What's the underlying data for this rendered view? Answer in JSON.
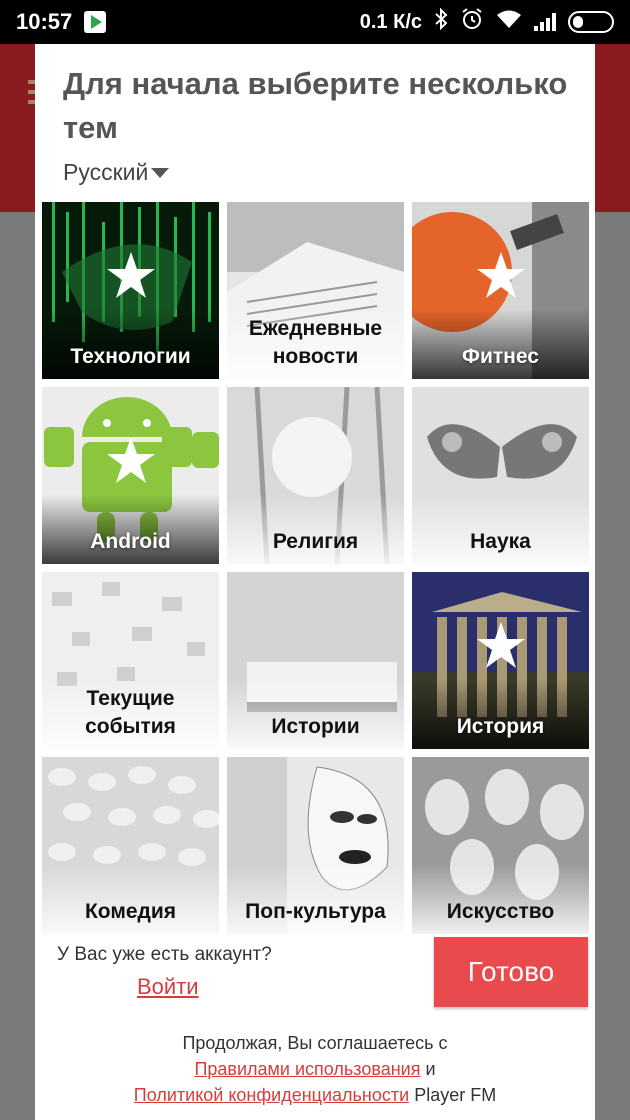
{
  "status_bar": {
    "time": "10:57",
    "network_speed": "0.1 К/с",
    "icons": [
      "google-play-icon",
      "bluetooth-icon",
      "alarm-icon",
      "wifi-icon",
      "signal-icon",
      "battery-icon"
    ]
  },
  "dialog": {
    "title": "Для начала выберите несколько тем",
    "language": "Русский",
    "topics": [
      {
        "label": "Технологии",
        "selected": true,
        "style": "dark"
      },
      {
        "label": "Ежедневные новости",
        "selected": false,
        "style": "light"
      },
      {
        "label": "Фитнес",
        "selected": true,
        "style": "dark"
      },
      {
        "label": "Android",
        "selected": true,
        "style": "dark"
      },
      {
        "label": "Религия",
        "selected": false,
        "style": "light"
      },
      {
        "label": "Наука",
        "selected": false,
        "style": "light"
      },
      {
        "label": "Текущие события",
        "selected": false,
        "style": "light"
      },
      {
        "label": "Истории",
        "selected": false,
        "style": "light"
      },
      {
        "label": "История",
        "selected": true,
        "style": "dark"
      },
      {
        "label": "Комедия",
        "selected": false,
        "style": "light"
      },
      {
        "label": "Поп-культура",
        "selected": false,
        "style": "light"
      },
      {
        "label": "Искусство",
        "selected": false,
        "style": "light"
      }
    ],
    "have_account_text": "У Вас уже есть аккаунт?",
    "login_link": "Войти",
    "done_button": "Готово",
    "terms_prefix": "Продолжая, Вы соглашаетесь с",
    "terms_link": "Правилами использования",
    "terms_and": "и",
    "privacy_link": "Политикой конфиденциальности",
    "terms_suffix": "Player FM"
  },
  "colors": {
    "accent": "#e84a4d",
    "link": "#d63c3c",
    "background_app_bar": "#8a1c20"
  }
}
